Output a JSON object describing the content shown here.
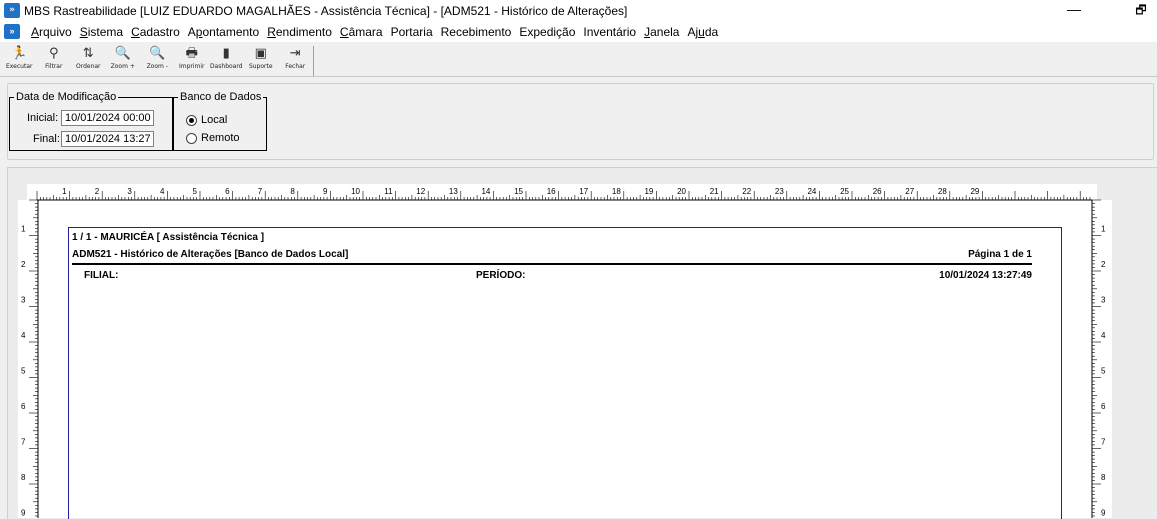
{
  "window": {
    "title": "MBS Rastreabilidade [LUIZ EDUARDO MAGALHÃES - Assistência Técnica] - [ADM521 - Histórico de Alterações]",
    "minimize_glyph": "—",
    "restore_glyph": "🗗",
    "app_icon_glyph": "»",
    "app_icon": "app-logo-icon"
  },
  "menu": {
    "items": [
      {
        "label": "Arquivo",
        "accel": "A"
      },
      {
        "label": "Sistema",
        "accel": "S"
      },
      {
        "label": "Cadastro",
        "accel": "C"
      },
      {
        "label": "Apontamento",
        "accel": "p"
      },
      {
        "label": "Rendimento",
        "accel": "R"
      },
      {
        "label": "Câmara",
        "accel": "C"
      },
      {
        "label": "Portaria",
        "accel": ""
      },
      {
        "label": "Recebimento",
        "accel": ""
      },
      {
        "label": "Expedição",
        "accel": ""
      },
      {
        "label": "Inventário",
        "accel": ""
      },
      {
        "label": "Janela",
        "accel": "J"
      },
      {
        "label": "Ajuda",
        "accel": "u"
      }
    ]
  },
  "toolbar": {
    "buttons": [
      {
        "label": "Executar",
        "icon": "run-icon",
        "glyph": "🏃"
      },
      {
        "label": "Filtrar",
        "icon": "filter-icon",
        "glyph": "⚲"
      },
      {
        "label": "Ordenar",
        "icon": "sort-icon",
        "glyph": "⇅"
      },
      {
        "label": "Zoom +",
        "icon": "zoom-in-icon",
        "glyph": "🔍"
      },
      {
        "label": "Zoom -",
        "icon": "zoom-out-icon",
        "glyph": "🔍"
      },
      {
        "label": "Imprimir",
        "icon": "printer-icon",
        "glyph": "🖶"
      },
      {
        "label": "Dashboard",
        "icon": "dashboard-icon",
        "glyph": "▮"
      },
      {
        "label": "Suporte",
        "icon": "support-icon",
        "glyph": "▣"
      },
      {
        "label": "Fechar",
        "icon": "exit-icon",
        "glyph": "⇥"
      }
    ]
  },
  "filters": {
    "date_group": {
      "legend": "Data de Modificação",
      "initial_label": "Inicial:",
      "initial_value": "10/01/2024 00:00",
      "final_label": "Final:",
      "final_value": "10/01/2024 13:27"
    },
    "db_group": {
      "legend": "Banco de Dados",
      "options": [
        {
          "label": "Local",
          "selected": true
        },
        {
          "label": "Remoto",
          "selected": false
        }
      ]
    }
  },
  "ruler": {
    "top_numbers": [
      "1",
      "2",
      "3",
      "4",
      "5",
      "6",
      "7",
      "8",
      "9",
      "10",
      "11",
      "12",
      "13",
      "14",
      "15",
      "16",
      "17",
      "18",
      "19",
      "20",
      "21",
      "22",
      "23",
      "24",
      "25",
      "26",
      "27",
      "28",
      "29"
    ],
    "side_numbers": [
      "1",
      "2",
      "3",
      "4",
      "5",
      "6",
      "7",
      "8",
      "9"
    ]
  },
  "report": {
    "line1": "1 / 1 - MAURICÉA [ Assistência Técnica ]",
    "line2": "ADM521 - Histórico de Alterações   [Banco de Dados Local]",
    "page_label": "Página 1 de 1",
    "filial_label": "FILIAL:",
    "periodo_label": "PERÍODO:",
    "datetime": "10/01/2024  13:27:49"
  }
}
